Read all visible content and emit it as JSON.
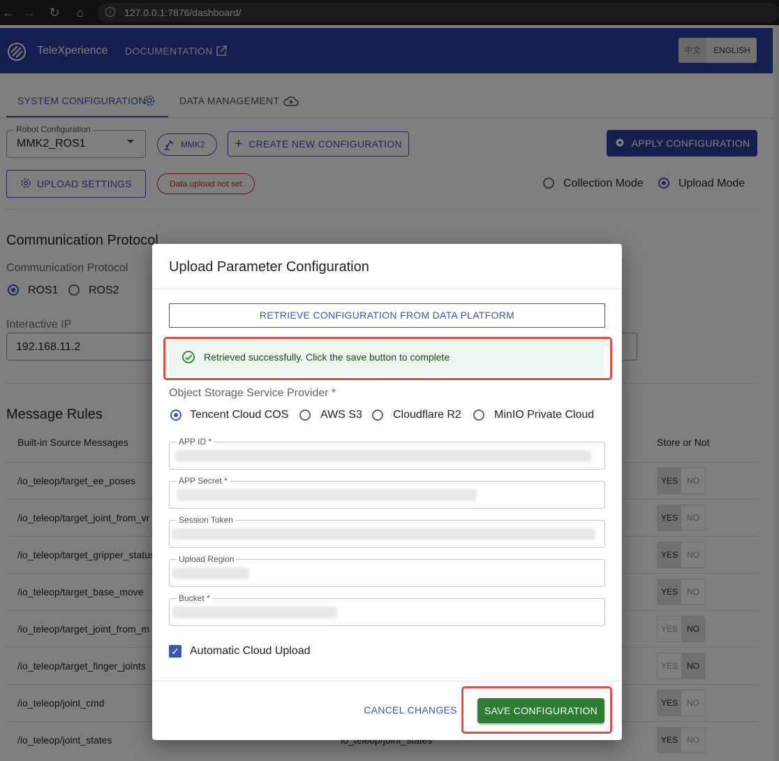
{
  "browser": {
    "url": "127.0.0.1:7876/dashboard/"
  },
  "appbar": {
    "brand": "TeleXperience",
    "docs": "DOCUMENTATION",
    "lang_zh": "中文",
    "lang_en": "ENGLISH"
  },
  "tabs": [
    {
      "label": "SYSTEM CONFIGURATION",
      "active": true
    },
    {
      "label": "DATA MANAGEMENT",
      "active": false
    }
  ],
  "toolbar": {
    "robot_config_label": "Robot Configuration",
    "robot_config_value": "MMK2_ROS1",
    "robot_chip": "MMK2",
    "create_new": "CREATE NEW CONFIGURATION",
    "apply": "APPLY CONFIGURATION",
    "upload_settings": "UPLOAD SETTINGS",
    "upload_status": "Data upload not set",
    "mode_collection": "Collection Mode",
    "mode_upload": "Upload Mode",
    "selected_mode": "Upload Mode"
  },
  "comm": {
    "section_title": "Communication Protocol",
    "protocol_label": "Communication Protocol",
    "options": [
      "ROS1",
      "ROS2"
    ],
    "selected": "ROS1",
    "ip_label": "Interactive IP",
    "ip_value": "192.168.11.2"
  },
  "rules": {
    "section_title": "Message Rules",
    "col_source": "Built-in Source Messages",
    "col_store": "Store or Not",
    "yes": "YES",
    "no": "NO",
    "rows": [
      {
        "msg": "/io_teleop/target_ee_poses",
        "store": "YES"
      },
      {
        "msg": "/io_teleop/target_joint_from_vr",
        "store": "YES"
      },
      {
        "msg": "/io_teleop/target_gripper_status",
        "store": "YES"
      },
      {
        "msg": "/io_teleop/target_base_move",
        "store": "YES"
      },
      {
        "msg": "/io_teleop/target_joint_from_m",
        "store": "NO"
      },
      {
        "msg": "/io_teleop/target_finger_joints",
        "store": "NO"
      },
      {
        "msg": "/io_teleop/joint_cmd",
        "store": "YES"
      },
      {
        "msg": "/io_teleop/joint_states",
        "store": "YES",
        "mapped": "io_teleop/joint_states"
      }
    ]
  },
  "dialog": {
    "title": "Upload Parameter Configuration",
    "retrieve": "RETRIEVE CONFIGURATION FROM DATA PLATFORM",
    "success": "Retrieved successfully. Click the save button to complete",
    "provider_label": "Object Storage Service Provider *",
    "providers": [
      "Tencent Cloud COS",
      "AWS S3",
      "Cloudflare R2",
      "MinIO Private Cloud"
    ],
    "selected_provider": "Tencent Cloud COS",
    "fields": [
      {
        "label": "APP ID *"
      },
      {
        "label": "APP Secret *"
      },
      {
        "label": "Session Token"
      },
      {
        "label": "Upload Region"
      },
      {
        "label": "Bucket *"
      }
    ],
    "auto_upload": "Automatic Cloud Upload",
    "auto_upload_checked": true,
    "cancel": "CANCEL CHANGES",
    "save": "SAVE CONFIGURATION"
  },
  "colors": {
    "primary": "#3f51b5",
    "appbar": "#2a3f9e",
    "save": "#2e7d32",
    "highlight": "#d74f4f"
  }
}
